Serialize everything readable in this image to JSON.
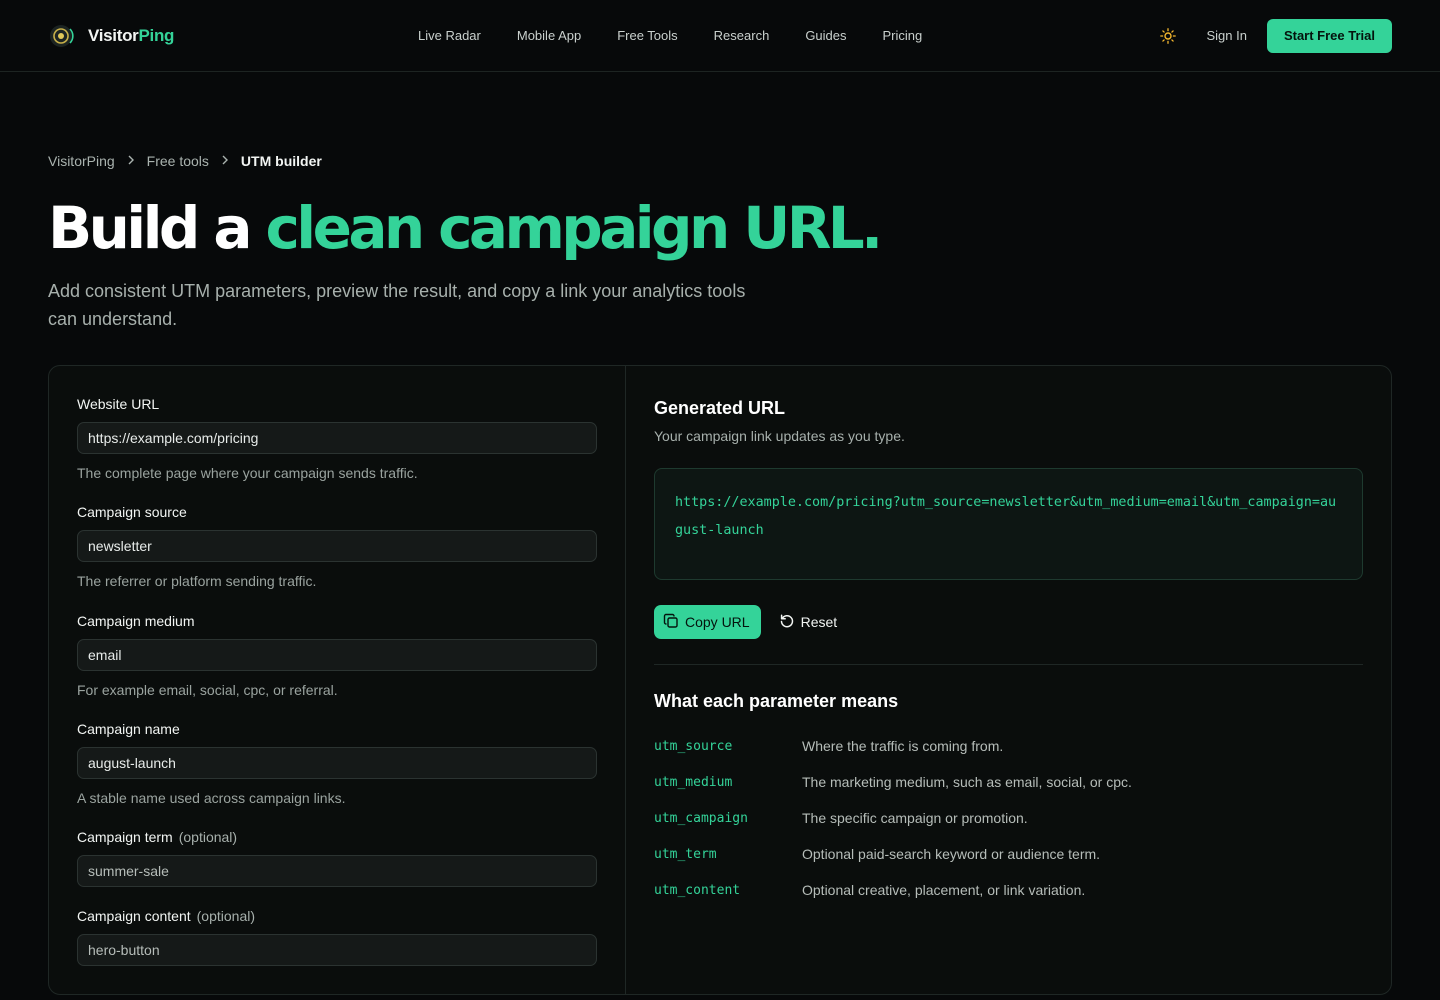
{
  "brand": {
    "name_part1": "Visitor",
    "name_part2": "Ping"
  },
  "nav": [
    "Live Radar",
    "Mobile App",
    "Free Tools",
    "Research",
    "Guides",
    "Pricing"
  ],
  "header": {
    "sign_in": "Sign In",
    "cta": "Start Free Trial"
  },
  "breadcrumb": {
    "home": "VisitorPing",
    "section": "Free tools",
    "current": "UTM builder"
  },
  "hero": {
    "title_white": "Build a",
    "title_green": "clean campaign URL.",
    "subtitle": "Add consistent UTM parameters, preview the result, and copy a link your analytics tools can understand."
  },
  "form": {
    "fields": [
      {
        "label": "Website URL",
        "optional": "",
        "value": "https://example.com/pricing",
        "placeholder": "",
        "help": "The complete page where your campaign sends traffic."
      },
      {
        "label": "Campaign source",
        "optional": "",
        "value": "newsletter",
        "placeholder": "",
        "help": "The referrer or platform sending traffic."
      },
      {
        "label": "Campaign medium",
        "optional": "",
        "value": "email",
        "placeholder": "",
        "help": "For example email, social, cpc, or referral."
      },
      {
        "label": "Campaign name",
        "optional": "",
        "value": "august-launch",
        "placeholder": "",
        "help": "A stable name used across campaign links."
      },
      {
        "label": "Campaign term",
        "optional": "(optional)",
        "value": "",
        "placeholder": "summer-sale",
        "help": ""
      },
      {
        "label": "Campaign content",
        "optional": "(optional)",
        "value": "",
        "placeholder": "hero-button",
        "help": ""
      }
    ]
  },
  "output": {
    "title": "Generated URL",
    "subtitle": "Your campaign link updates as you type.",
    "url": "https://example.com/pricing?utm_source=newsletter&utm_medium=email&utm_campaign=august-launch",
    "copy_label": "Copy URL",
    "reset_label": "Reset"
  },
  "params": {
    "title": "What each parameter means",
    "rows": [
      {
        "key": "utm_source",
        "desc": "Where the traffic is coming from."
      },
      {
        "key": "utm_medium",
        "desc": "The marketing medium, such as email, social, or cpc."
      },
      {
        "key": "utm_campaign",
        "desc": "The specific campaign or promotion."
      },
      {
        "key": "utm_term",
        "desc": "Optional paid-search keyword or audience term."
      },
      {
        "key": "utm_content",
        "desc": "Optional creative, placement, or link variation."
      }
    ]
  },
  "colors": {
    "accent": "#34d399",
    "background": "#07090a",
    "sun": "#f5b82e"
  },
  "icons": {
    "logo": "radar-logo-icon",
    "theme": "sun-icon",
    "copy": "copy-icon",
    "reset": "reset-icon",
    "breadcrumb_separator": "chevron-right-icon"
  }
}
